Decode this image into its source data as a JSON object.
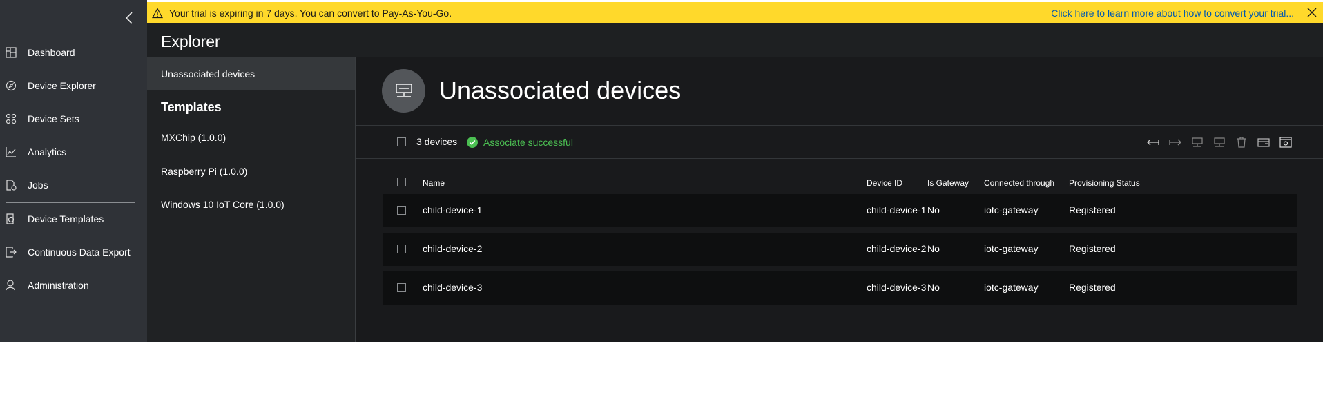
{
  "banner": {
    "message": "Your trial is expiring in 7 days. You can convert to Pay-As-You-Go.",
    "link": "Click here to learn more about how to convert your trial..."
  },
  "nav": {
    "items": [
      {
        "label": "Dashboard",
        "icon": "dashboard-icon"
      },
      {
        "label": "Device Explorer",
        "icon": "device-explorer-icon"
      },
      {
        "label": "Device Sets",
        "icon": "device-sets-icon"
      },
      {
        "label": "Analytics",
        "icon": "analytics-icon"
      },
      {
        "label": "Jobs",
        "icon": "jobs-icon"
      },
      {
        "label": "Device Templates",
        "icon": "device-templates-icon"
      },
      {
        "label": "Continuous Data Export",
        "icon": "data-export-icon"
      },
      {
        "label": "Administration",
        "icon": "administration-icon"
      }
    ]
  },
  "header": {
    "title": "Explorer"
  },
  "side": {
    "selected": "Unassociated devices",
    "templates_heading": "Templates",
    "templates": [
      "MXChip (1.0.0)",
      "Raspberry Pi (1.0.0)",
      "Windows 10 IoT Core (1.0.0)"
    ]
  },
  "main": {
    "title": "Unassociated devices",
    "count": "3 devices",
    "status": "Associate successful"
  },
  "table": {
    "headers": [
      "Name",
      "Device ID",
      "Is Gateway",
      "Connected through",
      "Provisioning Status"
    ],
    "rows": [
      [
        "child-device-1",
        "child-device-1",
        "No",
        "iotc-gateway",
        "Registered"
      ],
      [
        "child-device-2",
        "child-device-2",
        "No",
        "iotc-gateway",
        "Registered"
      ],
      [
        "child-device-3",
        "child-device-3",
        "No",
        "iotc-gateway",
        "Registered"
      ]
    ]
  },
  "colors": {
    "banner": "#ffd92b",
    "nav_bg": "#2f3237",
    "success": "#4bbf52",
    "link": "#0058b0"
  }
}
